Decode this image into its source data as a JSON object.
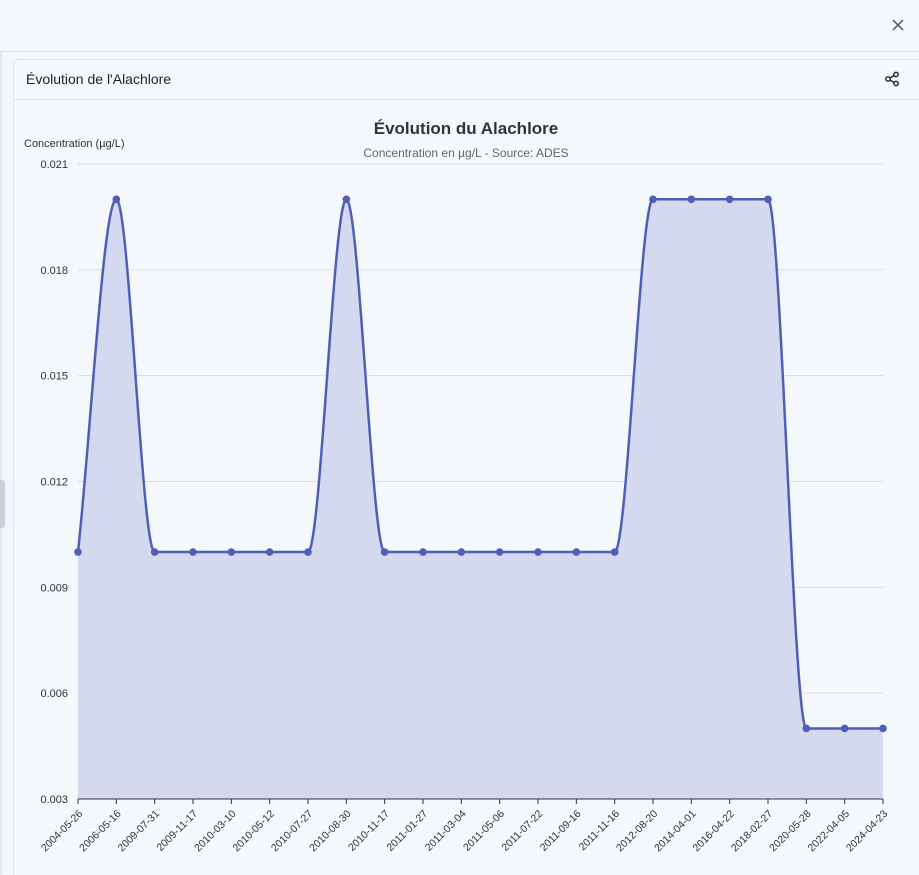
{
  "window": {
    "close_icon": "close-icon"
  },
  "panel": {
    "title": "Évolution de l'Alachlore",
    "share_icon": "share-icon"
  },
  "chart_data": {
    "type": "area",
    "title": "Évolution du Alachlore",
    "subtitle": "Concentration en µg/L - Source: ADES",
    "ylabel": "Concentration (µg/L)",
    "xlabel": "",
    "ylim": [
      0.003,
      0.021
    ],
    "yticks": [
      "0.003",
      "0.006",
      "0.009",
      "0.012",
      "0.015",
      "0.018",
      "0.021"
    ],
    "grid": true,
    "legend": "none",
    "color": "#4f5fb8",
    "fill_color": "#d5d9ef",
    "categories": [
      "2004-05-26",
      "2006-05-16",
      "2009-07-31",
      "2009-11-17",
      "2010-03-10",
      "2010-05-12",
      "2010-07-27",
      "2010-08-30",
      "2010-11-17",
      "2011-01-27",
      "2011-03-04",
      "2011-05-06",
      "2011-07-22",
      "2011-09-16",
      "2011-11-16",
      "2012-08-20",
      "2014-04-01",
      "2016-04-22",
      "2018-02-27",
      "2020-05-28",
      "2022-04-05",
      "2024-04-23"
    ],
    "values": [
      0.01,
      0.02,
      0.01,
      0.01,
      0.01,
      0.01,
      0.01,
      0.02,
      0.01,
      0.01,
      0.01,
      0.01,
      0.01,
      0.01,
      0.01,
      0.02,
      0.02,
      0.02,
      0.02,
      0.005,
      0.005,
      0.005
    ]
  }
}
